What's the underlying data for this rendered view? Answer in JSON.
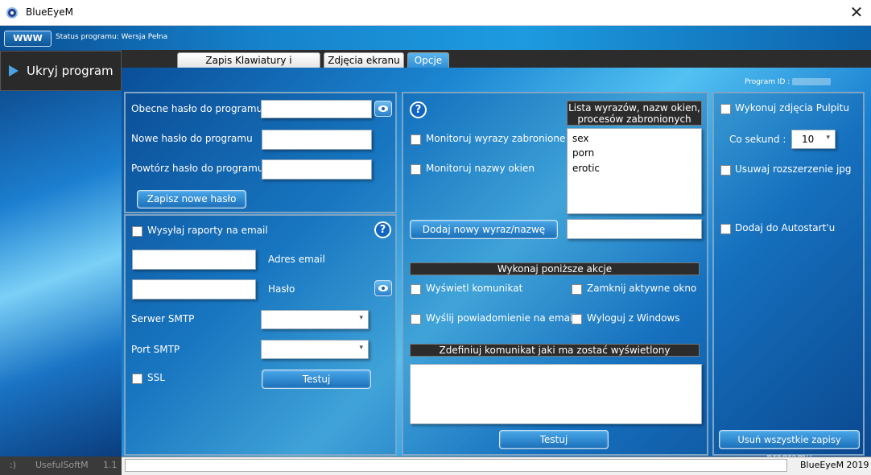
{
  "window": {
    "title": "BlueEyeM",
    "close_glyph": "✕"
  },
  "status": {
    "www_label": "WWW",
    "text": "Status programu: Wersja Pełna"
  },
  "tabs": [
    {
      "label": "Zapis Klawiatury i programów"
    },
    {
      "label": "Zdjęcia ekranu"
    },
    {
      "label": "Opcje",
      "active": true
    }
  ],
  "sidebar": {
    "hide_label": "Ukryj program",
    "footer": {
      "smiley": ":)",
      "company": "UsefulSoftM",
      "version": "1.1"
    }
  },
  "program_id": {
    "label": "Program ID :"
  },
  "password_panel": {
    "current_label": "Obecne hasło do programu",
    "new_label": "Nowe hasło do programu",
    "repeat_label": "Powtórz hasło do programu",
    "save_button": "Zapisz nowe hasło"
  },
  "email_panel": {
    "send_reports_label": "Wysyłaj raporty na email",
    "email_label": "Adres email",
    "password_label": "Hasło",
    "smtp_server_label": "Serwer SMTP",
    "smtp_port_label": "Port SMTP",
    "ssl_label": "SSL",
    "test_button": "Testuj"
  },
  "monitor_panel": {
    "help_glyph": "?",
    "list_header": "Lista wyrazów, nazw okien, procesów zabronionych",
    "monitor_words_label": "Monitoruj wyrazy zabronione",
    "monitor_windows_label": "Monitoruj nazwy okien",
    "words": [
      "sex",
      "porn",
      "erotic"
    ],
    "add_button": "Dodaj nowy wyraz/nazwę",
    "actions_header": "Wykonaj poniższe akcje",
    "show_message_label": "Wyświetl komunikat",
    "close_window_label": "Zamknij aktywne okno",
    "send_email_label": "Wyślij powiadomienie na email",
    "logout_label": "Wyloguj z Windows",
    "message_header": "Zdefiniuj komunikat jaki ma zostać wyświetlony",
    "test_button": "Testuj"
  },
  "screenshot_panel": {
    "take_label": "Wykonuj zdjęcia Pulpitu",
    "every_label": "Co sekund :",
    "every_value": "10",
    "remove_ext_label": "Usuwaj rozszerzenie jpg",
    "autostart_label": "Dodaj do Autostart'u",
    "delete_all_button": "Usuń wszystkie zapisy programu"
  },
  "footer": {
    "right_text": "BlueEyeM 2019"
  },
  "colors": {
    "accent": "#1d8ad8",
    "dark_header": "#2c2c2c"
  }
}
